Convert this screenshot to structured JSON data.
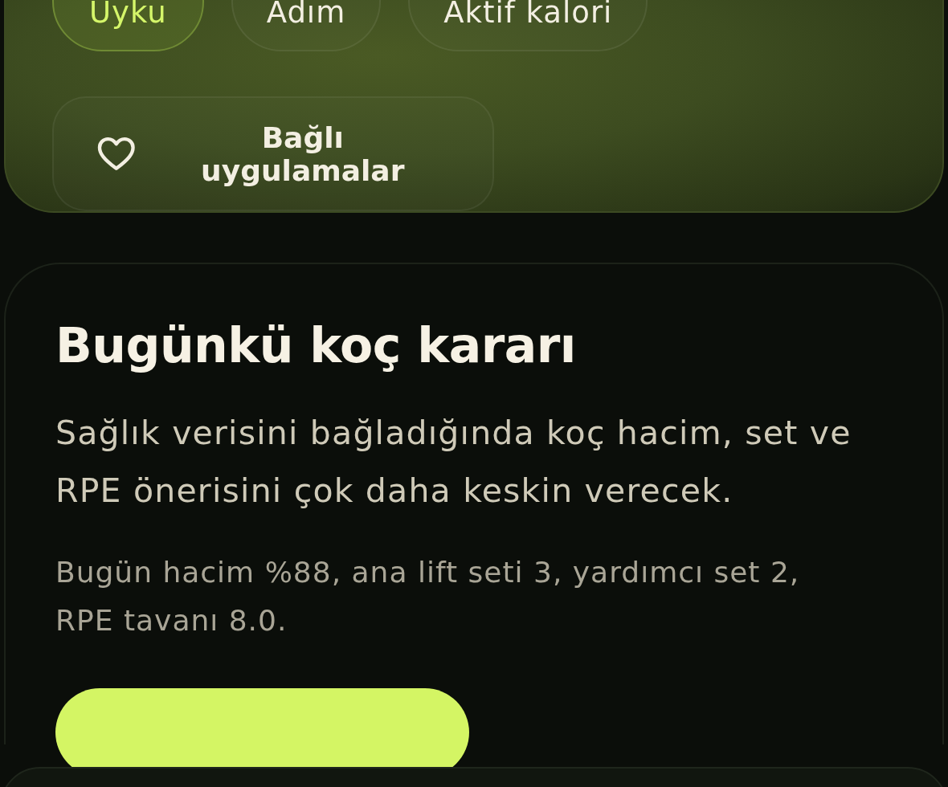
{
  "metric_tabs": [
    {
      "label": "Uyku",
      "selected": true
    },
    {
      "label": "Adım",
      "selected": false
    },
    {
      "label": "Aktif kalori",
      "selected": false
    }
  ],
  "connected_apps_button": {
    "label": "Bağlı uygulamalar"
  },
  "coach_card": {
    "title": "Bugünkü koç kararı",
    "description": "Sağlık verisini bağladığında koç hacim, set ve RPE önerisini çok daha keskin verecek.",
    "summary": "Bugün hacim %88, ana lift seti 3, yardımcı set 2, RPE tavanı 8.0."
  }
}
